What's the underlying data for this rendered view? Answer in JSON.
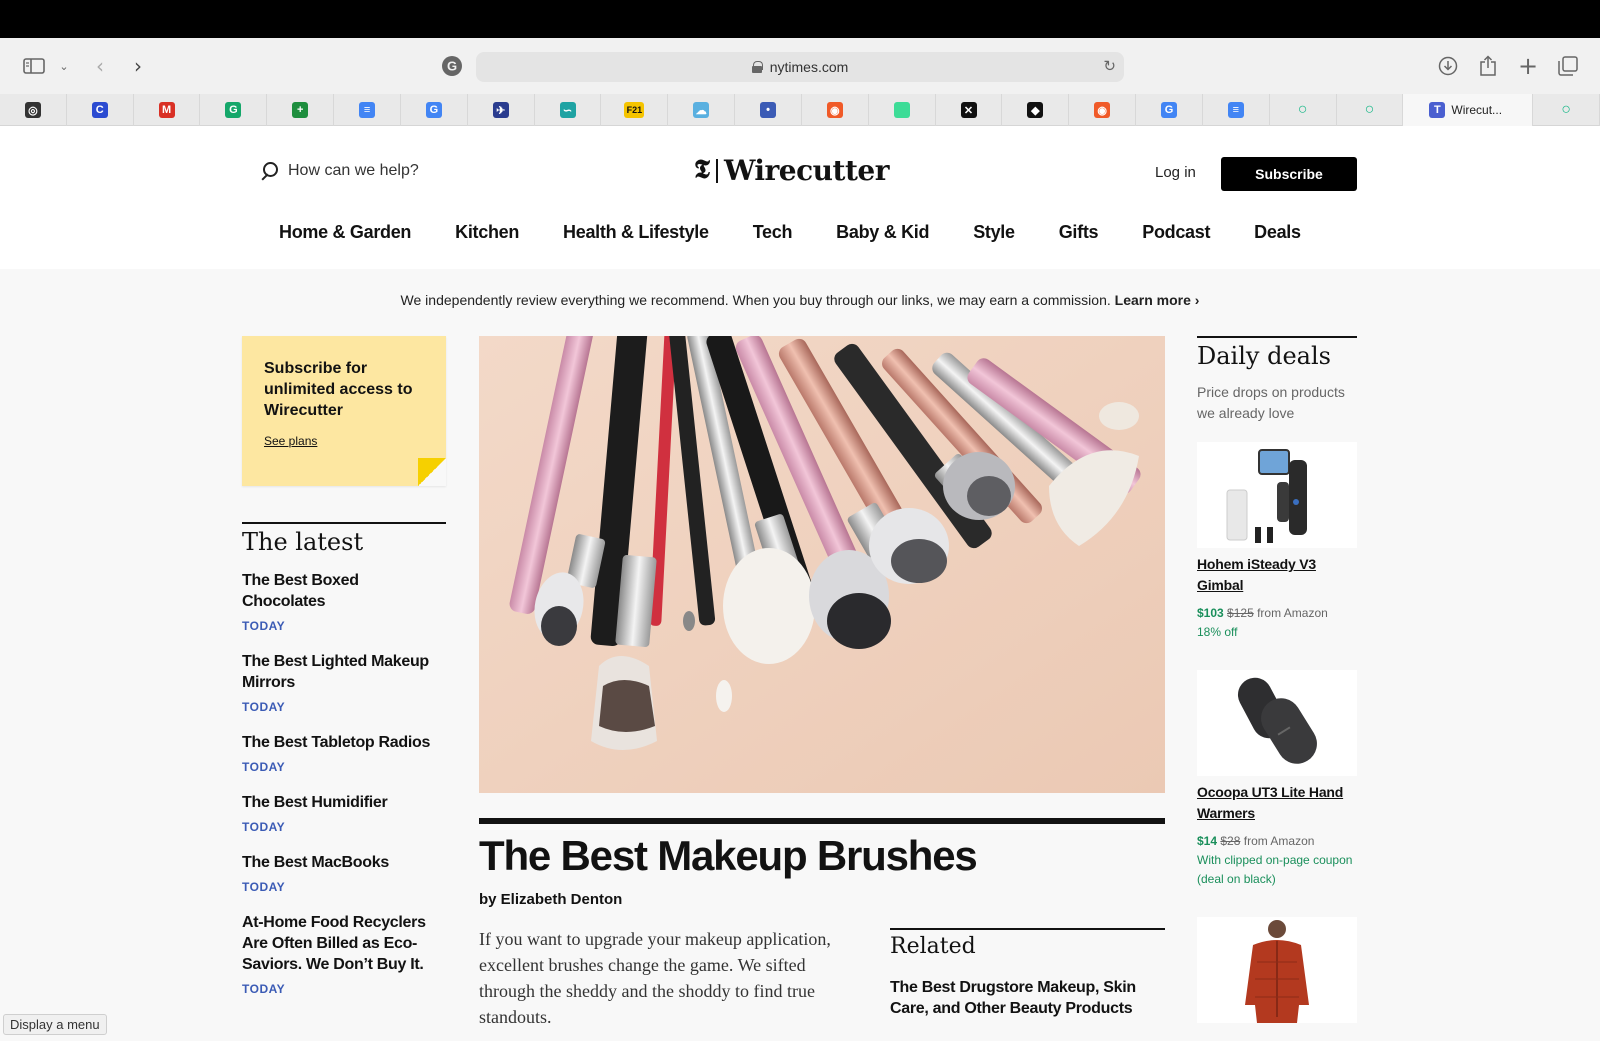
{
  "browser": {
    "url": "nytimes.com",
    "active_tab_label": "Wirecut...",
    "bookmark_icons": [
      "openai-icon",
      "c-icon",
      "gmail-icon",
      "grammarly-icon",
      "sheets-icon",
      "docs-icon",
      "google-icon",
      "bird-icon",
      "link-icon",
      "f21-icon",
      "cloud-icon",
      "dot-icon",
      "semrush-icon",
      "green-square-icon",
      "x-icon",
      "github-icon",
      "semrush-icon",
      "google-icon",
      "docs-icon",
      "ring-icon",
      "ring-icon",
      "nyt-icon",
      "ring-icon"
    ],
    "bookmark_colors": [
      "#333333",
      "#2b4bd1",
      "#d93025",
      "#15a76a",
      "#1e8e3e",
      "#4285f4",
      "#4285f4",
      "#2a3c8f",
      "#1fa3a3",
      "#f5c400",
      "#5ab0e0",
      "#3b5bb5",
      "#f05a28",
      "#3ddc97",
      "#111111",
      "#111111",
      "#f05a28",
      "#4285f4",
      "#4285f4",
      "#1db98a",
      "#1db98a",
      "#4a5fd0",
      "#1db98a"
    ],
    "bookmark_glyphs": [
      "◎",
      "C",
      "M",
      "G",
      "+",
      "≡",
      "G",
      "✈",
      "∽",
      "F21",
      "☁",
      "•",
      "◉",
      "",
      "✕",
      "◆",
      "◉",
      "G",
      "≡",
      "○",
      "○",
      "T",
      "○"
    ]
  },
  "header": {
    "search_placeholder": "How can we help?",
    "logo_mark": "𝕿",
    "logo_word": "Wirecutter",
    "login": "Log in",
    "subscribe": "Subscribe",
    "nav": [
      "Home & Garden",
      "Kitchen",
      "Health & Lifestyle",
      "Tech",
      "Baby & Kid",
      "Style",
      "Gifts",
      "Podcast",
      "Deals"
    ]
  },
  "disclaimer": {
    "text": "We independently review everything we recommend. When you buy through our links, we may earn a commission.",
    "link": "Learn more ›"
  },
  "promo": {
    "text": "Subscribe for unlimited access to Wirecutter",
    "link": "See plans"
  },
  "latest": {
    "heading": "The latest",
    "items": [
      {
        "title": "The Best Boxed Chocolates",
        "date": "TODAY"
      },
      {
        "title": "The Best Lighted Makeup Mirrors",
        "date": "TODAY"
      },
      {
        "title": "The Best Tabletop Radios",
        "date": "TODAY"
      },
      {
        "title": "The Best Humidifier",
        "date": "TODAY"
      },
      {
        "title": "The Best MacBooks",
        "date": "TODAY"
      },
      {
        "title": "At-Home Food Recyclers Are Often Billed as Eco-Saviors. We Don’t Buy It.",
        "date": "TODAY"
      }
    ]
  },
  "hero": {
    "title": "The Best Makeup Brushes",
    "byline": "by Elizabeth Denton",
    "dek": "If you want to upgrade your makeup application, excellent brushes change the game. We sifted through the sheddy and the shoddy to find true standouts."
  },
  "related": {
    "heading": "Related",
    "link": "The Best Drugstore Makeup, Skin Care, and Other Beauty Products"
  },
  "deals": {
    "heading": "Daily deals",
    "subheading": "Price drops on products we already love",
    "items": [
      {
        "name": "Hohem iSteady V3 Gimbal",
        "now": "$103",
        "was": "$125",
        "source": "from Amazon",
        "note": "18% off"
      },
      {
        "name": "Ocoopa UT3 Lite Hand Warmers",
        "now": "$14",
        "was": "$28",
        "source": "from Amazon",
        "note": "With clipped on-page coupon (deal on black)"
      },
      {
        "name": "",
        "now": "",
        "was": "",
        "source": "",
        "note": ""
      }
    ]
  },
  "tooltip": "Display a menu"
}
